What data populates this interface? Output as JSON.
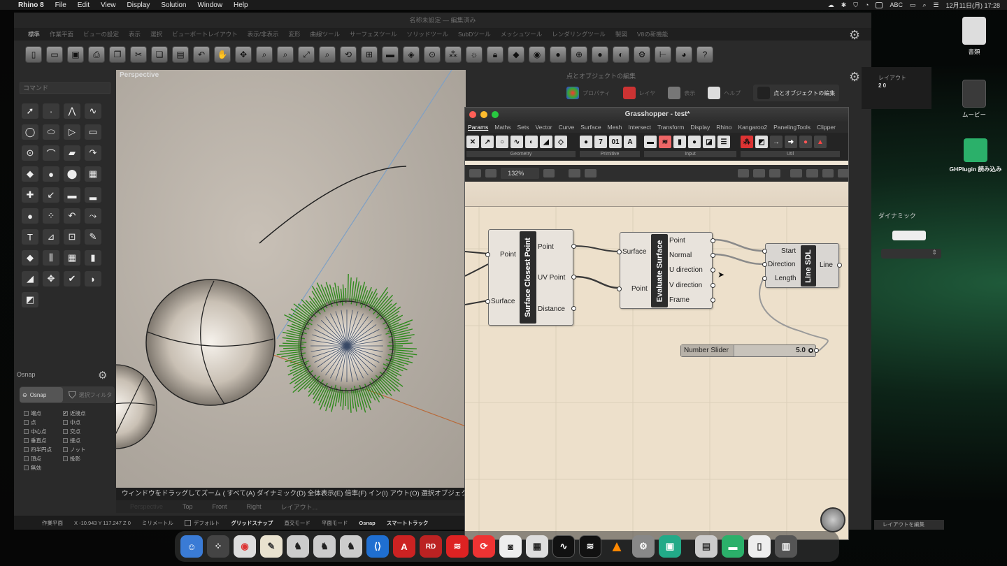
{
  "menubar": {
    "app": "Rhino 8",
    "items": [
      "File",
      "Edit",
      "View",
      "Display",
      "Solution",
      "Window",
      "Help"
    ],
    "input_mode": "ABC",
    "date_time": "12月11日(月) 17:28"
  },
  "rhino": {
    "window_title": "名称未設定 — 編集済み",
    "tabs": [
      "標準",
      "作業平面",
      "ビューの設定",
      "表示",
      "選択",
      "ビューポートレイアウト",
      "表示/非表示",
      "変形",
      "曲線ツール",
      "サーフェスツール",
      "ソリッドツール",
      "SubDツール",
      "メッシュツール",
      "レンダリングツール",
      "製図",
      "V8の新機能"
    ],
    "command_placeholder": "コマンド",
    "viewport_label": "Perspective",
    "command_prompt": "ウィンドウをドラッグしてズーム ( すべて(A) ダイナミック(D) 全体表示(E) 倍率(F) イン(I) アウト(O) 選択オブジェクト",
    "view_tabs": [
      "Perspective",
      "Top",
      "Front",
      "Right",
      "レイアウト..."
    ],
    "status": {
      "plane": "作業平面",
      "coords": "X -10.943 Y 117.247 Z 0",
      "units": "ミリメートル",
      "layer": "デフォルト",
      "gridsnap": "グリッドスナップ",
      "ortho": "直交モード",
      "planar": "平面モード",
      "osnap": "Osnap",
      "smarttrack": "スマートトラック"
    },
    "osnap": {
      "title": "Osnap",
      "tab_osnap": "Osnap",
      "tab_filter": "選択フィルタ",
      "items": [
        {
          "label": "端点",
          "checked": false
        },
        {
          "label": "近接点",
          "checked": true
        },
        {
          "label": "点",
          "checked": false
        },
        {
          "label": "中点",
          "checked": false
        },
        {
          "label": "中心点",
          "checked": false
        },
        {
          "label": "交点",
          "checked": false
        },
        {
          "label": "垂直点",
          "checked": false
        },
        {
          "label": "接点",
          "checked": false
        },
        {
          "label": "四半円点",
          "checked": false
        },
        {
          "label": "ノット",
          "checked": false
        },
        {
          "label": "頂点",
          "checked": false
        },
        {
          "label": "投影",
          "checked": false
        },
        {
          "label": "無効",
          "checked": false
        }
      ]
    },
    "panel": {
      "title": "点とオブジェクトの編集",
      "tabs": [
        "プロパティ",
        "レイヤ",
        "表示",
        "ヘルプ",
        "点とオブジェクトの編集"
      ]
    },
    "right": {
      "layout_label": "レイアウト",
      "layout_value": "2 0",
      "dynamic": "ダイナミック",
      "edit_layout": "レイアウトを編集"
    }
  },
  "grasshopper": {
    "title": "Grasshopper - test*",
    "menu": [
      "Params",
      "Maths",
      "Sets",
      "Vector",
      "Curve",
      "Surface",
      "Mesh",
      "Intersect",
      "Transform",
      "Display",
      "Rhino",
      "Kangaroo2",
      "PanelingTools",
      "Clipper"
    ],
    "groups": [
      {
        "label": "Geometry"
      },
      {
        "label": "Primitive"
      },
      {
        "label": "Input"
      },
      {
        "label": "Util"
      }
    ],
    "zoom": "132%",
    "components": [
      {
        "name": "Surface Closest Point",
        "inputs": [
          "Point",
          "Surface"
        ],
        "outputs": [
          "Point",
          "UV Point",
          "Distance"
        ]
      },
      {
        "name": "Evaluate Surface",
        "inputs": [
          "Surface",
          "Point"
        ],
        "outputs": [
          "Point",
          "Normal",
          "U direction",
          "V direction",
          "Frame"
        ]
      },
      {
        "name": "Line SDL",
        "inputs": [
          "Start",
          "Direction",
          "Length"
        ],
        "outputs": [
          "Line"
        ]
      }
    ],
    "slider": {
      "label": "Number Slider",
      "value": "5.0"
    }
  },
  "desktop": {
    "icons": [
      {
        "label": "書類"
      },
      {
        "label": "ムービー"
      },
      {
        "label": "GHPlugin 読み込み"
      }
    ]
  },
  "colors": {
    "gh_canvas": "#ede0cb",
    "component_name": "#2c2c2c",
    "green_vectors": "#2e8a1c",
    "wire": "#8a8a8a"
  }
}
